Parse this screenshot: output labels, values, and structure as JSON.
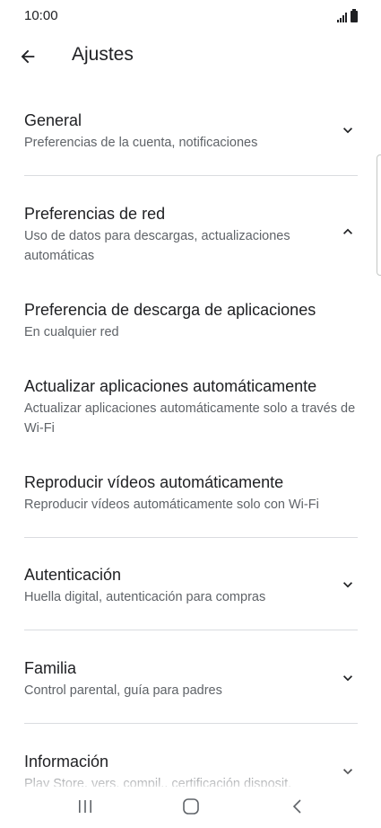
{
  "status_bar": {
    "time": "10:00"
  },
  "app_bar": {
    "title": "Ajustes",
    "back_icon": "arrow-left-icon"
  },
  "settings": {
    "general": {
      "title": "General",
      "subtitle": "Preferencias de la cuenta, notificaciones",
      "expanded": false
    },
    "network": {
      "title": "Preferencias de red",
      "subtitle": "Uso de datos para descargas, actualizaciones automáticas",
      "expanded": true,
      "items": [
        {
          "title": "Preferencia de descarga de aplicaciones",
          "subtitle": "En cualquier red"
        },
        {
          "title": "Actualizar aplicaciones automáticamente",
          "subtitle": "Actualizar aplicaciones automáticamente solo a través de Wi-Fi"
        },
        {
          "title": "Reproducir vídeos automáticamente",
          "subtitle": "Reproducir vídeos automáticamente solo con Wi-Fi"
        }
      ]
    },
    "authentication": {
      "title": "Autenticación",
      "subtitle": "Huella digital, autenticación para compras",
      "expanded": false
    },
    "family": {
      "title": "Familia",
      "subtitle": "Control parental, guía para padres",
      "expanded": false
    },
    "about": {
      "title": "Información",
      "subtitle": "Play Store, vers. compil., certificación disposit.",
      "expanded": false
    }
  },
  "nav_bar": {
    "recents_icon": "recents-icon",
    "home_icon": "home-icon",
    "back_icon": "back-chevron-icon"
  },
  "colors": {
    "text_primary": "#202124",
    "text_secondary": "#5f6368",
    "divider": "#dadce0",
    "background": "#ffffff"
  }
}
